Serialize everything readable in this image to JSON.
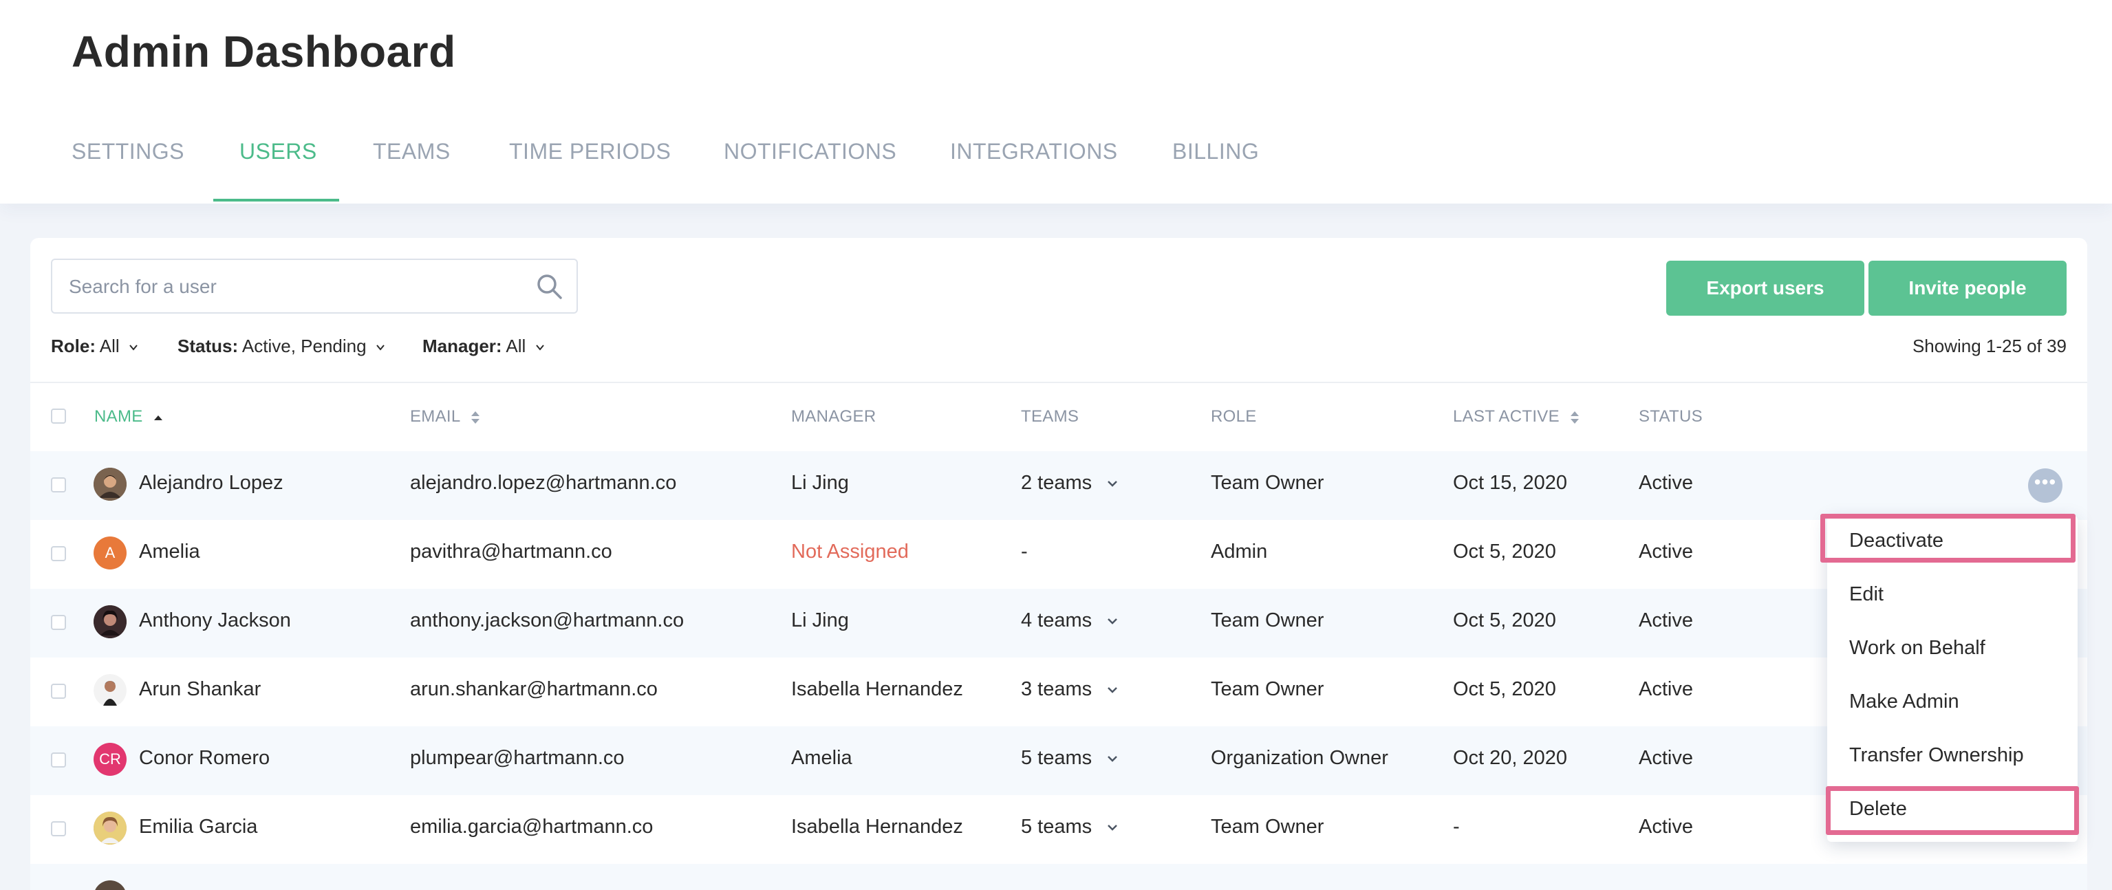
{
  "page_title": "Admin Dashboard",
  "tabs": [
    {
      "label": "SETTINGS"
    },
    {
      "label": "USERS"
    },
    {
      "label": "TEAMS"
    },
    {
      "label": "TIME PERIODS"
    },
    {
      "label": "NOTIFICATIONS"
    },
    {
      "label": "INTEGRATIONS"
    },
    {
      "label": "BILLING"
    }
  ],
  "active_tab": "USERS",
  "search": {
    "placeholder": "Search for a user",
    "value": ""
  },
  "buttons": {
    "export": "Export users",
    "invite": "Invite people"
  },
  "filters": {
    "role": {
      "key": "Role:",
      "value": "All"
    },
    "status": {
      "key": "Status:",
      "value": "Active, Pending"
    },
    "manager": {
      "key": "Manager:",
      "value": "All"
    }
  },
  "showing": "Showing 1-25 of 39",
  "columns": {
    "name": "NAME",
    "email": "EMAIL",
    "manager": "MANAGER",
    "teams": "TEAMS",
    "role": "ROLE",
    "last_active": "LAST ACTIVE",
    "status": "STATUS"
  },
  "rows": [
    {
      "name": "Alejandro Lopez",
      "email": "alejandro.lopez@hartmann.co",
      "manager": "Li Jing",
      "teams": "2 teams",
      "role": "Team Owner",
      "last_active": "Oct 15, 2020",
      "status": "Active",
      "avatar": {
        "kind": "photo",
        "color": "#5a4a3e"
      }
    },
    {
      "name": "Amelia",
      "email": "pavithra@hartmann.co",
      "manager": "Not Assigned",
      "teams": "-",
      "role": "Admin",
      "last_active": "Oct 5, 2020",
      "status": "Active",
      "avatar": {
        "kind": "initials",
        "initials": "A",
        "color": "#e8793a"
      }
    },
    {
      "name": "Anthony Jackson",
      "email": "anthony.jackson@hartmann.co",
      "manager": "Li Jing",
      "teams": "4 teams",
      "role": "Team Owner",
      "last_active": "Oct 5, 2020",
      "status": "Active",
      "avatar": {
        "kind": "photo",
        "color": "#2f2326"
      }
    },
    {
      "name": "Arun Shankar",
      "email": "arun.shankar@hartmann.co",
      "manager": "Isabella Hernandez",
      "teams": "3 teams",
      "role": "Team Owner",
      "last_active": "Oct 5, 2020",
      "status": "Active",
      "avatar": {
        "kind": "photo",
        "color": "#3a2b27"
      }
    },
    {
      "name": "Conor Romero",
      "email": "plumpear@hartmann.co",
      "manager": "Amelia",
      "teams": "5 teams",
      "role": "Organization Owner",
      "last_active": "Oct 20, 2020",
      "status": "Active",
      "avatar": {
        "kind": "initials",
        "initials": "CR",
        "color": "#e2376f"
      }
    },
    {
      "name": "Emilia Garcia",
      "email": "emilia.garcia@hartmann.co",
      "manager": "Isabella Hernandez",
      "teams": "5 teams",
      "role": "Team Owner",
      "last_active": "-",
      "status": "Active",
      "avatar": {
        "kind": "photo",
        "color": "#c9a86b"
      }
    }
  ],
  "context_menu": {
    "items": [
      "Deactivate",
      "Edit",
      "Work on Behalf",
      "Make Admin",
      "Transfer Ownership",
      "Delete"
    ]
  },
  "colors": {
    "accent": "#4cbb8a",
    "button": "#5cc393",
    "warn": "#e26a5a",
    "highlight": "#e36a92"
  },
  "icons": [
    "search-icon",
    "chevron-down-icon",
    "sort-icon",
    "more-icon"
  ]
}
